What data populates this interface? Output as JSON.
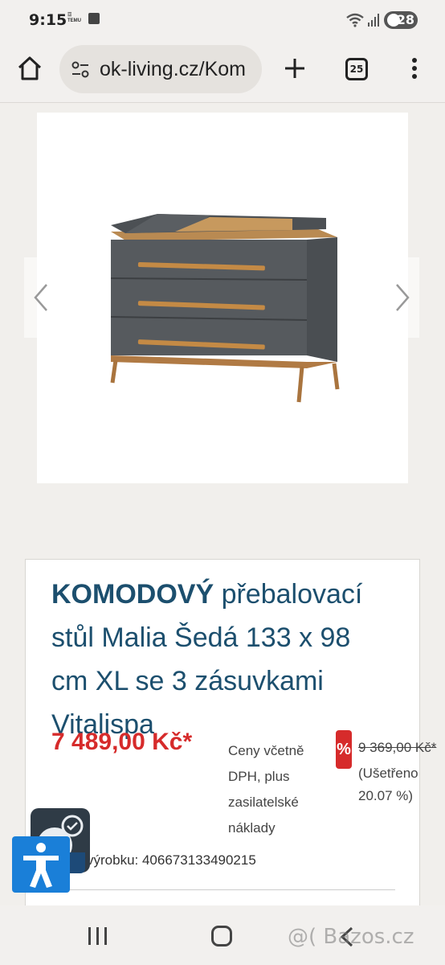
{
  "status_bar": {
    "time": "9:15",
    "temu_badge": "TEMU",
    "battery": "28"
  },
  "browser": {
    "url": "ok-living.cz/Kom",
    "tab_count": "25"
  },
  "product": {
    "title_bold": "KOMODOVÝ",
    "title_rest": " přebalovací stůl Malia Šedá 133 x 98 cm XL se 3 zásuvkami Vitalispa",
    "price": "7 489,00 Kč*",
    "vat_note": "Ceny včetně DPH, plus zasilatelské náklady",
    "discount_badge": "%",
    "old_price": "9 369,00 Kč*",
    "saved": "(Ušetřeno 20.07 %)",
    "product_code": "výrobku: 406673133490215"
  },
  "watermark": "@( Bazos.cz"
}
